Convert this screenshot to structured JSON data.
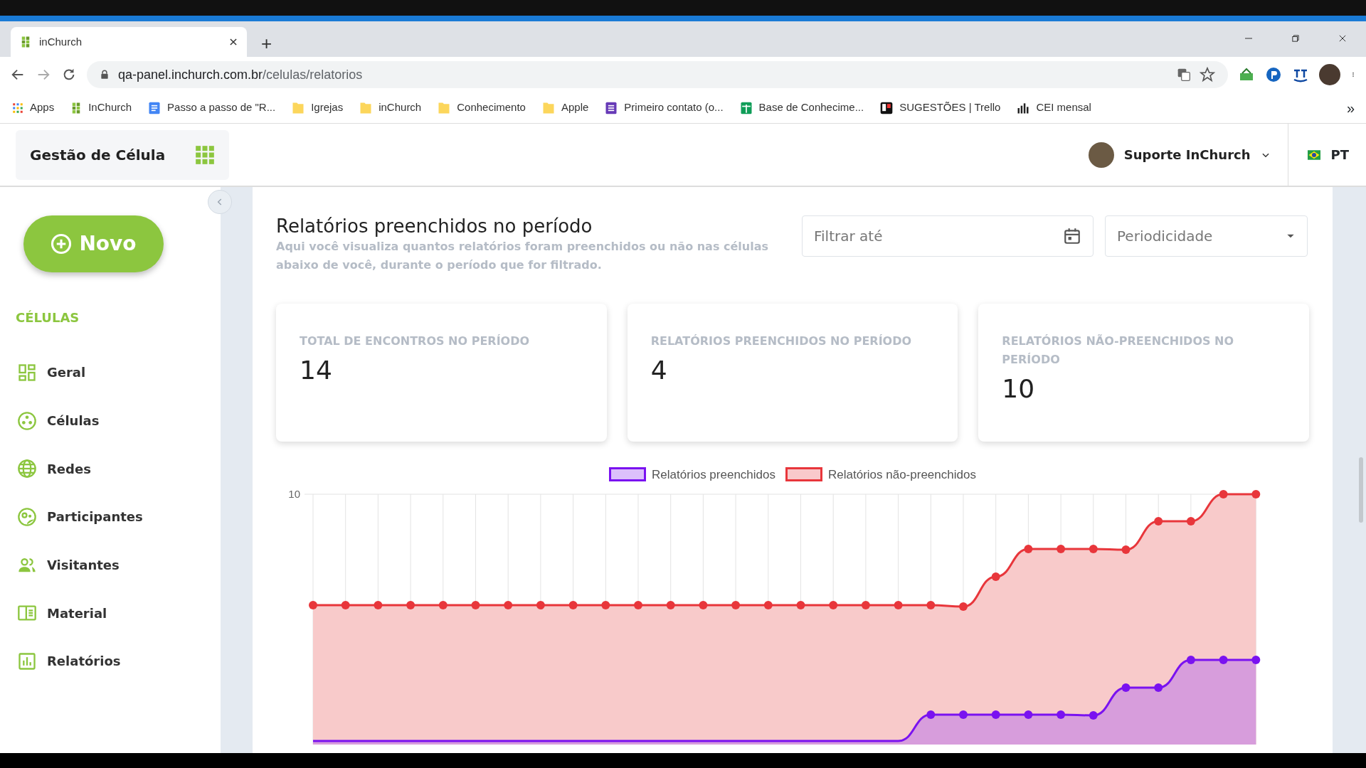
{
  "browser": {
    "tab_title": "inChurch",
    "new_tab": "+",
    "address": {
      "host": "qa-panel.inchurch.com.br",
      "path": "/celulas/relatorios"
    },
    "bookmarks": [
      {
        "label": "Apps",
        "kind": "apps"
      },
      {
        "label": "InChurch",
        "kind": "logo"
      },
      {
        "label": "Passo a passo de \"R...",
        "kind": "doc"
      },
      {
        "label": "Igrejas",
        "kind": "folder"
      },
      {
        "label": "inChurch",
        "kind": "folder"
      },
      {
        "label": "Conhecimento",
        "kind": "folder"
      },
      {
        "label": "Apple",
        "kind": "folder"
      },
      {
        "label": "Primeiro contato (o...",
        "kind": "form"
      },
      {
        "label": "Base de Conhecime...",
        "kind": "sheet"
      },
      {
        "label": "SUGESTÕES | Trello",
        "kind": "board"
      },
      {
        "label": "CEI mensal",
        "kind": "bars"
      }
    ],
    "bookmarks_overflow": "»"
  },
  "app": {
    "title": "Gestão de Célula",
    "user": "Suporte InChurch",
    "language": "PT",
    "new_button": "Novo",
    "section": "CÉLULAS",
    "nav": [
      {
        "label": "Geral",
        "kind": "grid"
      },
      {
        "label": "Células",
        "kind": "cells"
      },
      {
        "label": "Redes",
        "kind": "globe"
      },
      {
        "label": "Participantes",
        "kind": "faces"
      },
      {
        "label": "Visitantes",
        "kind": "people"
      },
      {
        "label": "Material",
        "kind": "book"
      },
      {
        "label": "Relatórios",
        "kind": "chart"
      }
    ]
  },
  "report": {
    "title": "Relatórios preenchidos no período",
    "description": "Aqui você visualiza quantos relatórios foram preenchidos ou não nas células abaixo de você, durante o período que for filtrado.",
    "filter": {
      "placeholder": "Filtrar até"
    },
    "period": {
      "placeholder": "Periodicidade"
    },
    "stats": [
      {
        "label": "TOTAL DE ENCONTROS NO PERÍODO",
        "value": "14"
      },
      {
        "label": "RELATÓRIOS PREENCHIDOS NO PERÍODO",
        "value": "4"
      },
      {
        "label": "RELATÓRIOS NÃO-PREENCHIDOS NO PERÍODO",
        "value": "10"
      }
    ],
    "chart": {
      "y_tick": "10",
      "legend": [
        {
          "name": "Relatórios preenchidos",
          "color": "#7a12f0"
        },
        {
          "name": "Relatórios não-preenchidos",
          "color": "#e8363b"
        }
      ]
    }
  }
}
